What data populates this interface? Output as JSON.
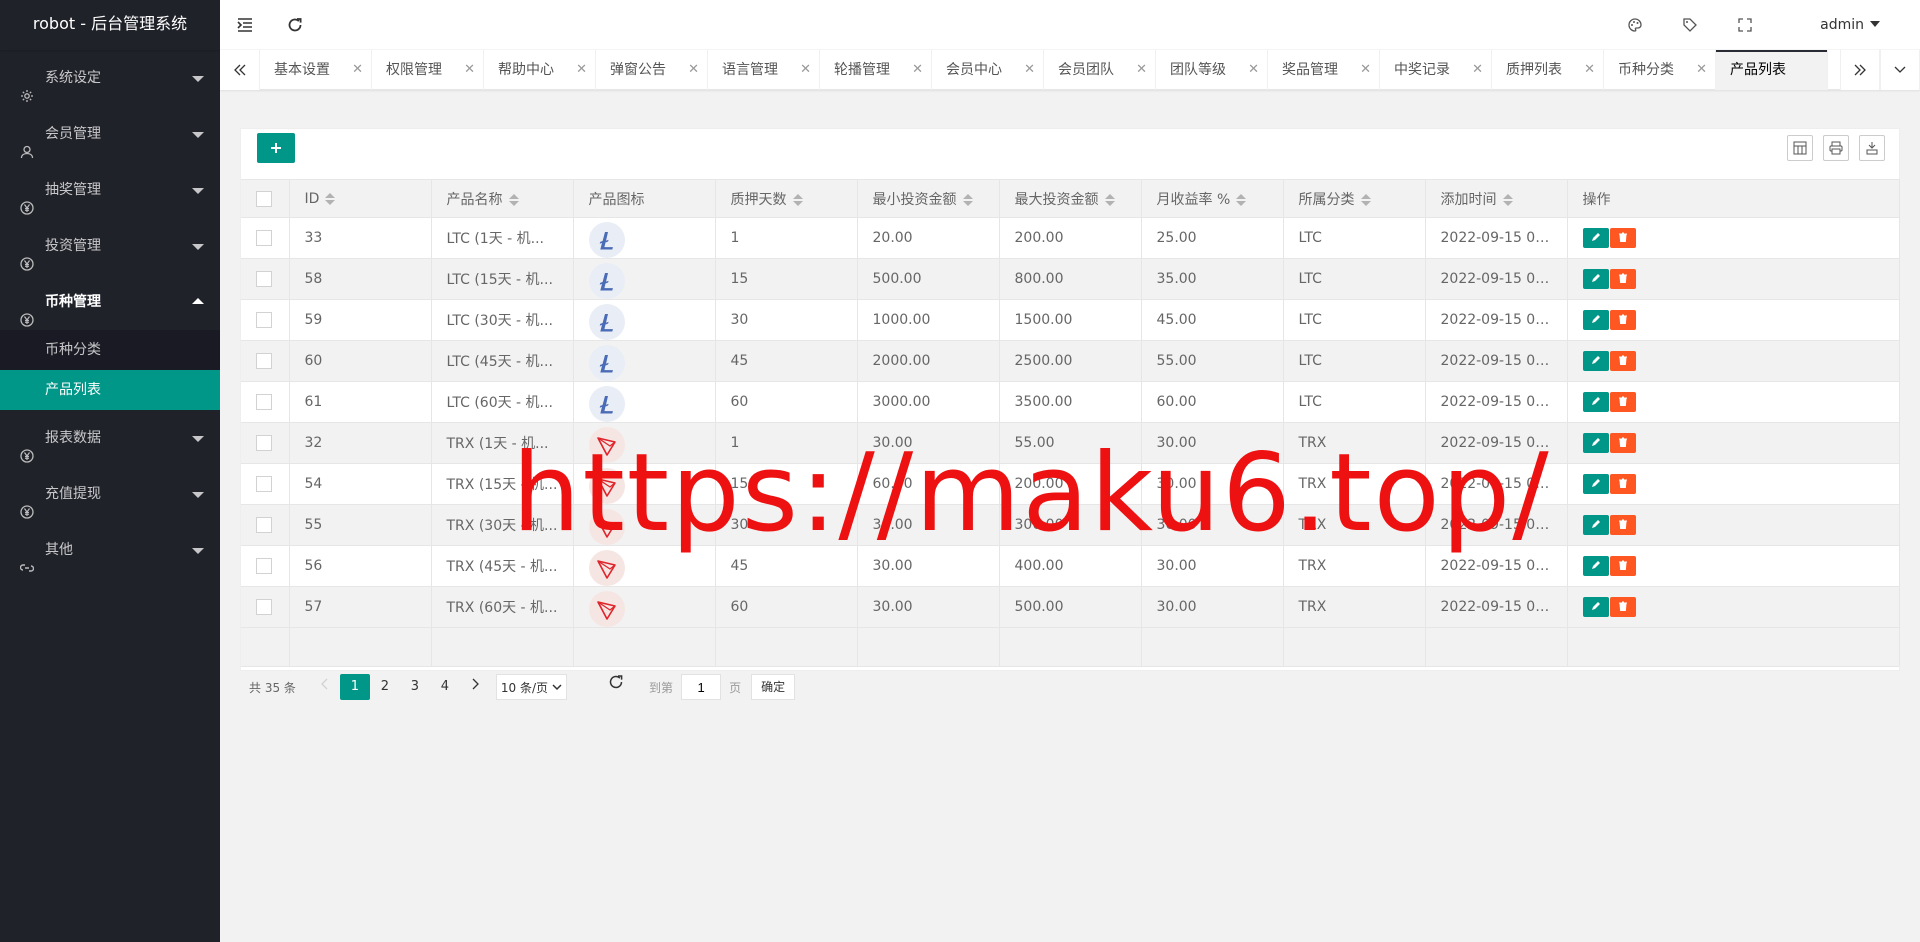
{
  "app": {
    "title": "robot - 后台管理系统"
  },
  "sidebar": {
    "items": [
      {
        "label": "系统设定",
        "icon": "gear-icon"
      },
      {
        "label": "会员管理",
        "icon": "user-icon"
      },
      {
        "label": "抽奖管理",
        "icon": "yen-icon"
      },
      {
        "label": "投资管理",
        "icon": "yen-icon"
      },
      {
        "label": "币种管理",
        "icon": "yen-icon",
        "open": true,
        "children": [
          {
            "label": "币种分类"
          },
          {
            "label": "产品列表",
            "active": true
          }
        ]
      },
      {
        "label": "报表数据",
        "icon": "yen-icon"
      },
      {
        "label": "充值提现",
        "icon": "yen-icon"
      },
      {
        "label": "其他",
        "icon": "link-icon"
      }
    ]
  },
  "header": {
    "user": "admin"
  },
  "tabs": [
    {
      "label": "基本设置"
    },
    {
      "label": "权限管理"
    },
    {
      "label": "帮助中心"
    },
    {
      "label": "弹窗公告"
    },
    {
      "label": "语言管理"
    },
    {
      "label": "轮播管理"
    },
    {
      "label": "会员中心"
    },
    {
      "label": "会员团队"
    },
    {
      "label": "团队等级"
    },
    {
      "label": "奖品管理"
    },
    {
      "label": "中奖记录"
    },
    {
      "label": "质押列表"
    },
    {
      "label": "币种分类"
    },
    {
      "label": "产品列表",
      "active": true
    }
  ],
  "table": {
    "add_label": "+",
    "columns": [
      "ID",
      "产品名称",
      "产品图标",
      "质押天数",
      "最小投资金额",
      "最大投资金额",
      "月收益率 %",
      "所属分类",
      "添加时间",
      "操作"
    ],
    "rows": [
      {
        "id": "33",
        "name": "LTC (1天 - 机...",
        "icon": "ltc",
        "days": "1",
        "min": "20.00",
        "max": "200.00",
        "rate": "25.00",
        "cat": "LTC",
        "time": "2022-09-15 01:..."
      },
      {
        "id": "58",
        "name": "LTC (15天 - 机...",
        "icon": "ltc",
        "days": "15",
        "min": "500.00",
        "max": "800.00",
        "rate": "35.00",
        "cat": "LTC",
        "time": "2022-09-15 01:..."
      },
      {
        "id": "59",
        "name": "LTC (30天 - 机...",
        "icon": "ltc",
        "days": "30",
        "min": "1000.00",
        "max": "1500.00",
        "rate": "45.00",
        "cat": "LTC",
        "time": "2022-09-15 01:..."
      },
      {
        "id": "60",
        "name": "LTC (45天 - 机...",
        "icon": "ltc",
        "days": "45",
        "min": "2000.00",
        "max": "2500.00",
        "rate": "55.00",
        "cat": "LTC",
        "time": "2022-09-15 01:..."
      },
      {
        "id": "61",
        "name": "LTC (60天 - 机...",
        "icon": "ltc",
        "days": "60",
        "min": "3000.00",
        "max": "3500.00",
        "rate": "60.00",
        "cat": "LTC",
        "time": "2022-09-15 01:..."
      },
      {
        "id": "32",
        "name": "TRX (1天 - 机...",
        "icon": "trx",
        "days": "1",
        "min": "30.00",
        "max": "55.00",
        "rate": "30.00",
        "cat": "TRX",
        "time": "2022-09-15 01:..."
      },
      {
        "id": "54",
        "name": "TRX (15天 - 机...",
        "icon": "trx",
        "days": "15",
        "min": "60.00",
        "max": "200.00",
        "rate": "30.00",
        "cat": "TRX",
        "time": "2022-09-15 01:..."
      },
      {
        "id": "55",
        "name": "TRX (30天 - 机...",
        "icon": "trx",
        "days": "30",
        "min": "30.00",
        "max": "300.00",
        "rate": "30.00",
        "cat": "TRX",
        "time": "2022-09-15 01:..."
      },
      {
        "id": "56",
        "name": "TRX (45天 - 机...",
        "icon": "trx",
        "days": "45",
        "min": "30.00",
        "max": "400.00",
        "rate": "30.00",
        "cat": "TRX",
        "time": "2022-09-15 01:..."
      },
      {
        "id": "57",
        "name": "TRX (60天 - 机...",
        "icon": "trx",
        "days": "60",
        "min": "30.00",
        "max": "500.00",
        "rate": "30.00",
        "cat": "TRX",
        "time": "2022-09-15 01:..."
      }
    ]
  },
  "pager": {
    "total": "共 35 条",
    "pages": [
      "1",
      "2",
      "3",
      "4"
    ],
    "current": "1",
    "page_size": "10 条/页",
    "goto_label": "到第",
    "goto_value": "1",
    "page_unit": "页",
    "confirm": "确定"
  },
  "watermark": "https://maku6.top/",
  "colors": {
    "accent": "#009688",
    "danger": "#ff5722",
    "sidebar": "#20222a",
    "watermark": "#ee1111"
  }
}
